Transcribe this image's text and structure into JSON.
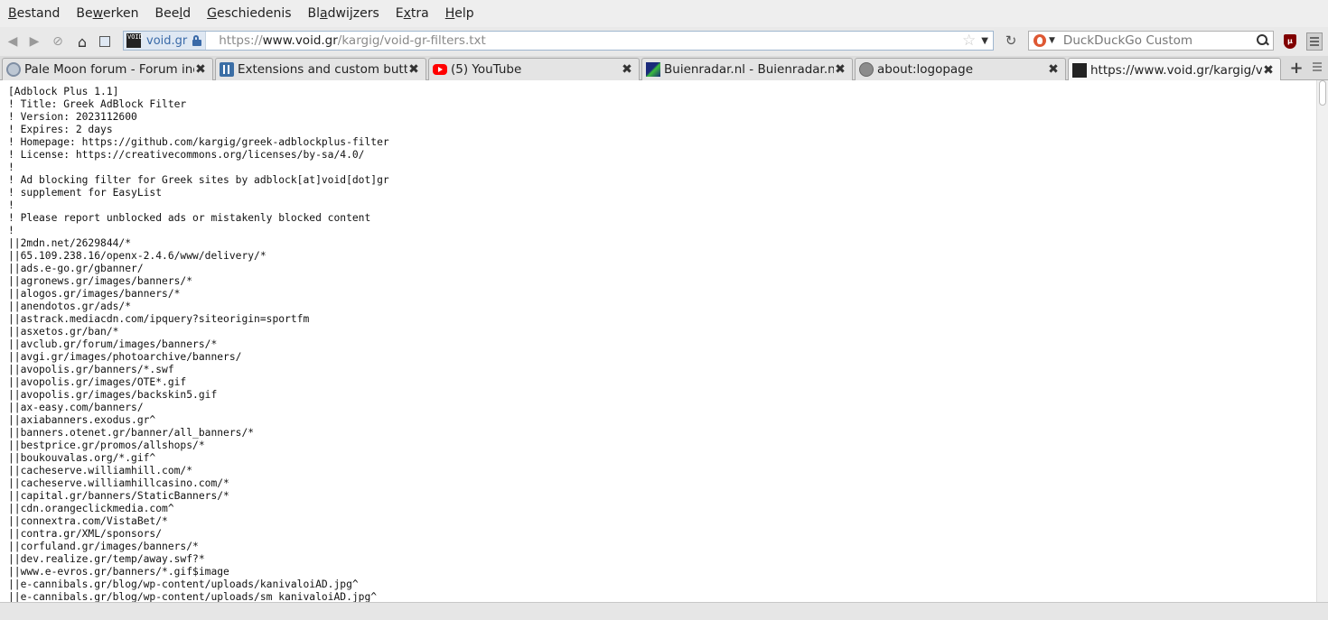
{
  "menubar": {
    "items": [
      {
        "pre": "",
        "ul": "B",
        "post": "estand"
      },
      {
        "pre": "Be",
        "ul": "w",
        "post": "erken"
      },
      {
        "pre": "Bee",
        "ul": "l",
        "post": "d"
      },
      {
        "pre": "",
        "ul": "G",
        "post": "eschiedenis"
      },
      {
        "pre": "Bl",
        "ul": "a",
        "post": "dwijzers"
      },
      {
        "pre": "E",
        "ul": "x",
        "post": "tra"
      },
      {
        "pre": "",
        "ul": "H",
        "post": "elp"
      }
    ]
  },
  "navbar": {
    "identity_text": "void.gr",
    "url_scheme": "https://",
    "url_host": "www.void.gr",
    "url_path": "/kargig/void-gr-filters.txt",
    "search_placeholder": "DuckDuckGo Custom",
    "ublock_label": "µ"
  },
  "tabs": [
    {
      "title": "Pale Moon forum - Forum index",
      "close": "✖"
    },
    {
      "title": "Extensions and custom buttons",
      "close": "✖"
    },
    {
      "title": "(5) YouTube",
      "close": "✖"
    },
    {
      "title": "Buienradar.nl - Buienradar.nl - weer",
      "close": "✖"
    },
    {
      "title": "about:logopage",
      "close": "✖"
    },
    {
      "title": "https://www.void.gr/kargig/void-gr-filters.txt",
      "close": "✖"
    }
  ],
  "newtab_label": "+",
  "content": {
    "lines": [
      "[Adblock Plus 1.1]",
      "! Title: Greek AdBlock Filter",
      "! Version: 2023112600",
      "! Expires: 2 days",
      "! Homepage: https://github.com/kargig/greek-adblockplus-filter",
      "! License: https://creativecommons.org/licenses/by-sa/4.0/",
      "!",
      "! Ad blocking filter for Greek sites by adblock[at]void[dot]gr",
      "! supplement for EasyList",
      "!",
      "! Please report unblocked ads or mistakenly blocked content",
      "!",
      "||2mdn.net/2629844/*",
      "||65.109.238.16/openx-2.4.6/www/delivery/*",
      "||ads.e-go.gr/gbanner/",
      "||agronews.gr/images/banners/*",
      "||alogos.gr/images/banners/*",
      "||anendotos.gr/ads/*",
      "||astrack.mediacdn.com/ipquery?siteorigin=sportfm",
      "||asxetos.gr/ban/*",
      "||avclub.gr/forum/images/banners/*",
      "||avgi.gr/images/photoarchive/banners/",
      "||avopolis.gr/banners/*.swf",
      "||avopolis.gr/images/OTE*.gif",
      "||avopolis.gr/images/backskin5.gif",
      "||ax-easy.com/banners/",
      "||axiabanners.exodus.gr^",
      "||banners.otenet.gr/banner/all_banners/*",
      "||bestprice.gr/promos/allshops/*",
      "||boukouvalas.org/*.gif^",
      "||cacheserve.williamhill.com/*",
      "||cacheserve.williamhillcasino.com/*",
      "||capital.gr/banners/StaticBanners/*",
      "||cdn.orangeclickmedia.com^",
      "||connextra.com/VistaBet/*",
      "||contra.gr/XML/sponsors/",
      "||corfuland.gr/images/banners/*",
      "||dev.realize.gr/temp/away.swf?*",
      "||www.e-evros.gr/banners/*.gif$image",
      "||e-cannibals.gr/blog/wp-content/uploads/kanivaloiAD.jpg^",
      "||e-cannibals.gr/blog/wp-content/uploads/sm_kanivaloiAD.jpg^"
    ]
  }
}
